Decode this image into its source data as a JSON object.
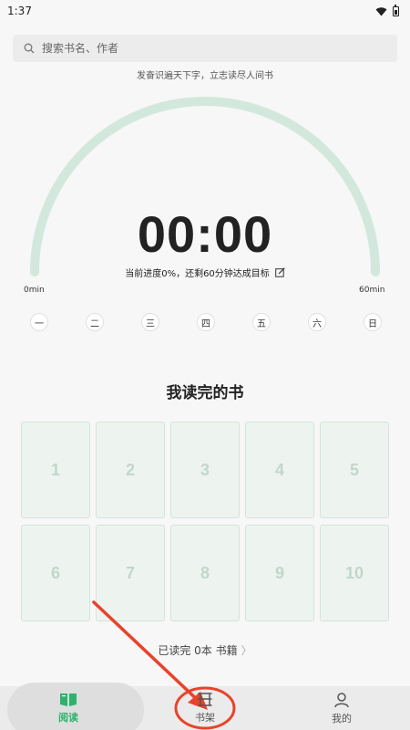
{
  "status_bar": {
    "time": "1:37"
  },
  "search": {
    "placeholder": "搜索书名、作者"
  },
  "quote": "发奋识遍天下字，立志读尽人间书",
  "timer": {
    "display": "00:00",
    "progress_text": "当前进度0%，还剩60分钟达成目标",
    "progress_fraction": 0,
    "min_label": "0min",
    "max_label": "60min",
    "arc_color": "#d3e8dc"
  },
  "weekdays": [
    "一",
    "二",
    "三",
    "四",
    "五",
    "六",
    "日"
  ],
  "finished": {
    "title": "我读完的书",
    "slots": [
      "1",
      "2",
      "3",
      "4",
      "5",
      "6",
      "7",
      "8",
      "9",
      "10"
    ],
    "count_text": "已读完 0本 书籍",
    "chevron": "〉"
  },
  "nav": {
    "accent": "#2eb26c",
    "items": [
      {
        "label": "阅读",
        "icon": "book-open-icon"
      },
      {
        "label": "书架",
        "icon": "bookshelf-icon"
      },
      {
        "label": "我的",
        "icon": "person-icon"
      }
    ]
  },
  "annotation_color": "#e8432b"
}
